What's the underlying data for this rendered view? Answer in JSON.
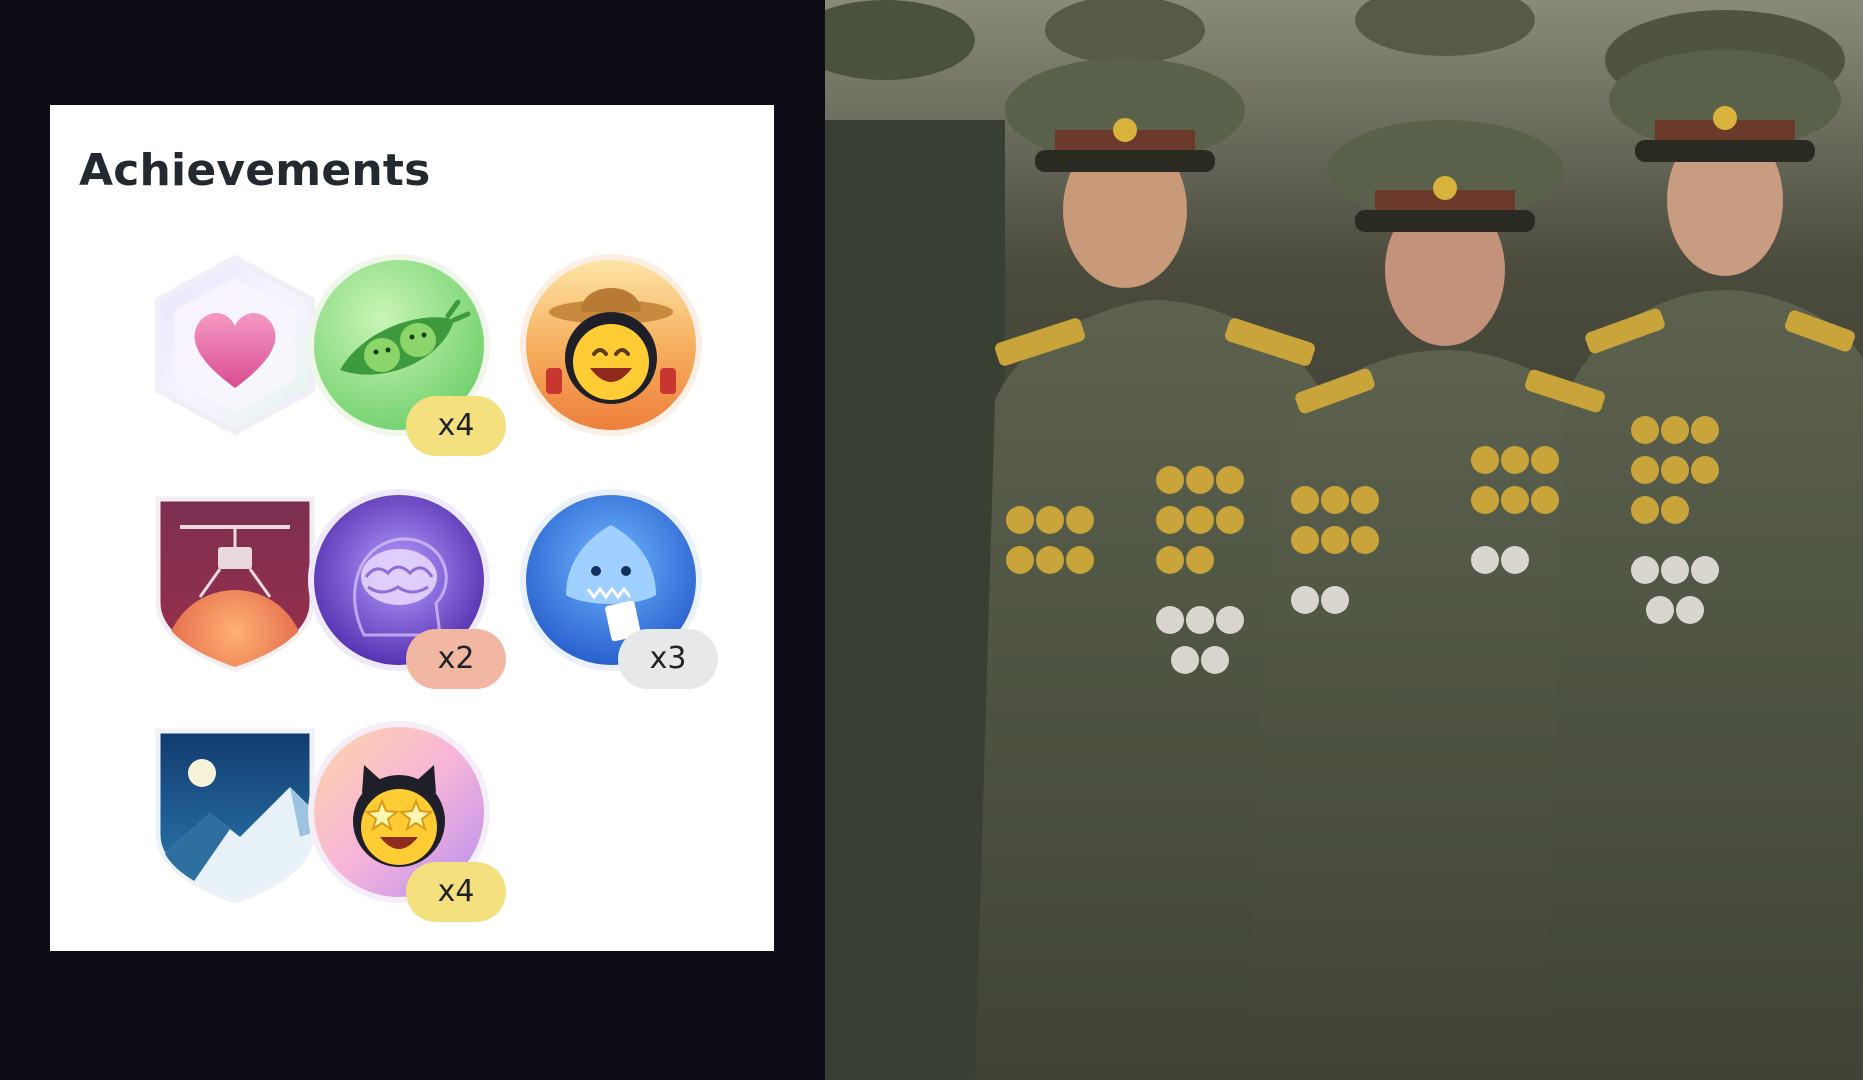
{
  "panel": {
    "title": "Achievements"
  },
  "badges": [
    {
      "name": "heart-on-sleeve",
      "icon": "heart-icon",
      "count": ""
    },
    {
      "name": "pair-extraordinaire",
      "icon": "peas-pod-icon",
      "count": "x4"
    },
    {
      "name": "yolo",
      "icon": "cowboy-octocat-icon",
      "count": ""
    },
    {
      "name": "mars-2020-contributor",
      "icon": "helicopter-mars-icon",
      "count": ""
    },
    {
      "name": "galaxy-brain",
      "icon": "brain-icon",
      "count": "x2"
    },
    {
      "name": "pull-shark",
      "icon": "shark-icon",
      "count": "x3"
    },
    {
      "name": "arctic-code-vault",
      "icon": "mountain-moon-icon",
      "count": ""
    },
    {
      "name": "starstruck",
      "icon": "star-eyes-octocat-icon",
      "count": "x4"
    }
  ],
  "colors": {
    "background": "#0e0c17",
    "card": "#ffffff",
    "title": "#24292f",
    "pill_yellow": "#f5e07f",
    "pill_peach": "#f1b7a2",
    "pill_grey": "#e7e8ea"
  },
  "photo": {
    "subject": "military-officers-photo"
  }
}
